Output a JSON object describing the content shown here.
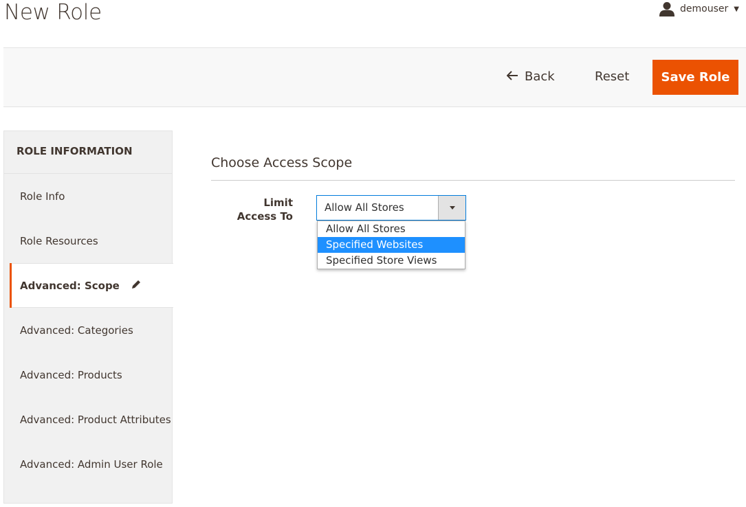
{
  "header": {
    "title": "New Role",
    "user": "demouser"
  },
  "actions": {
    "back": "Back",
    "reset": "Reset",
    "save": "Save Role"
  },
  "sidebar": {
    "heading": "ROLE INFORMATION",
    "items": [
      {
        "label": "Role Info"
      },
      {
        "label": "Role Resources"
      },
      {
        "label": "Advanced: Scope",
        "active": true
      },
      {
        "label": "Advanced: Categories"
      },
      {
        "label": "Advanced: Products"
      },
      {
        "label": "Advanced: Product Attributes"
      },
      {
        "label": "Advanced: Admin User Role"
      }
    ]
  },
  "main": {
    "section_title": "Choose Access Scope",
    "field_label": "Limit Access To",
    "select_value": "Allow All Stores",
    "options": [
      {
        "label": "Allow All Stores"
      },
      {
        "label": "Specified Websites",
        "highlighted": true
      },
      {
        "label": "Specified Store Views"
      }
    ]
  },
  "colors": {
    "accent": "#eb5202",
    "highlight": "#1e90ff",
    "focus_border": "#007bdb"
  }
}
